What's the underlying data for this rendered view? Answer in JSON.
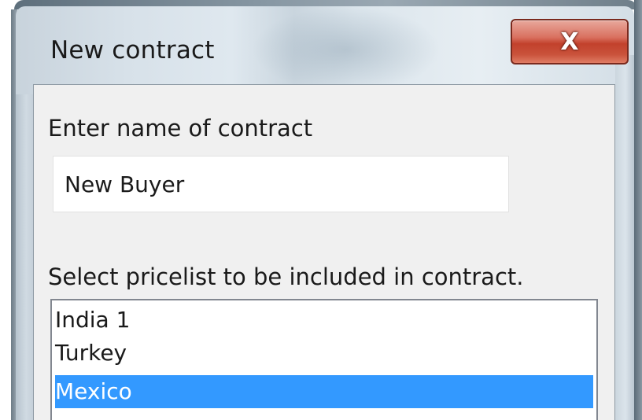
{
  "window": {
    "title": "New contract",
    "close_glyph": "X"
  },
  "form": {
    "name_label": "Enter name of contract",
    "name_value": "New Buyer",
    "pricelist_label": "Select pricelist to be included in contract."
  },
  "pricelists": {
    "items": [
      {
        "label": "India 1",
        "selected": false
      },
      {
        "label": "Turkey",
        "selected": false
      },
      {
        "label": "Mexico",
        "selected": true
      }
    ]
  },
  "colors": {
    "selection": "#3399ff",
    "close_button": "#c2412c"
  },
  "icons": {
    "close": "close-icon"
  }
}
